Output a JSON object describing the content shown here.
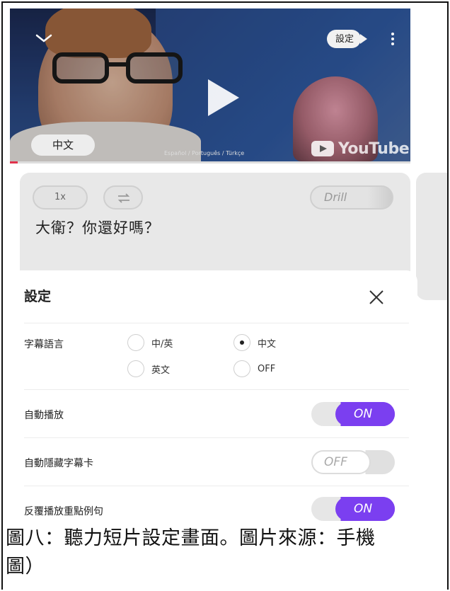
{
  "video": {
    "settings_label": "設定",
    "language_pill": "中文",
    "caption_languages": "Español / Português / Türkçe",
    "youtube_label": "YouTube",
    "progress_fraction": 0.02
  },
  "card": {
    "speed_label": "1x",
    "drill_label": "Drill",
    "sentence": "大衛？你還好嗎？"
  },
  "sheet": {
    "title": "設定",
    "subtitle_language": {
      "label": "字幕語言",
      "options": [
        "中/英",
        "中文",
        "英文",
        "OFF"
      ],
      "selected": "中文"
    },
    "autoplay": {
      "label": "自動播放",
      "state": "ON"
    },
    "auto_hide_card": {
      "label": "自動隱藏字幕卡",
      "state": "OFF"
    },
    "repeat_key_sentence": {
      "label": "反覆播放重點例句",
      "state": "ON"
    }
  },
  "figure_caption": {
    "line1": "圖八：聽力短片設定畫面。圖片來源：手機",
    "line2": "圖）"
  },
  "colors": {
    "accent": "#7b3ff0",
    "progress": "#e0324b"
  }
}
